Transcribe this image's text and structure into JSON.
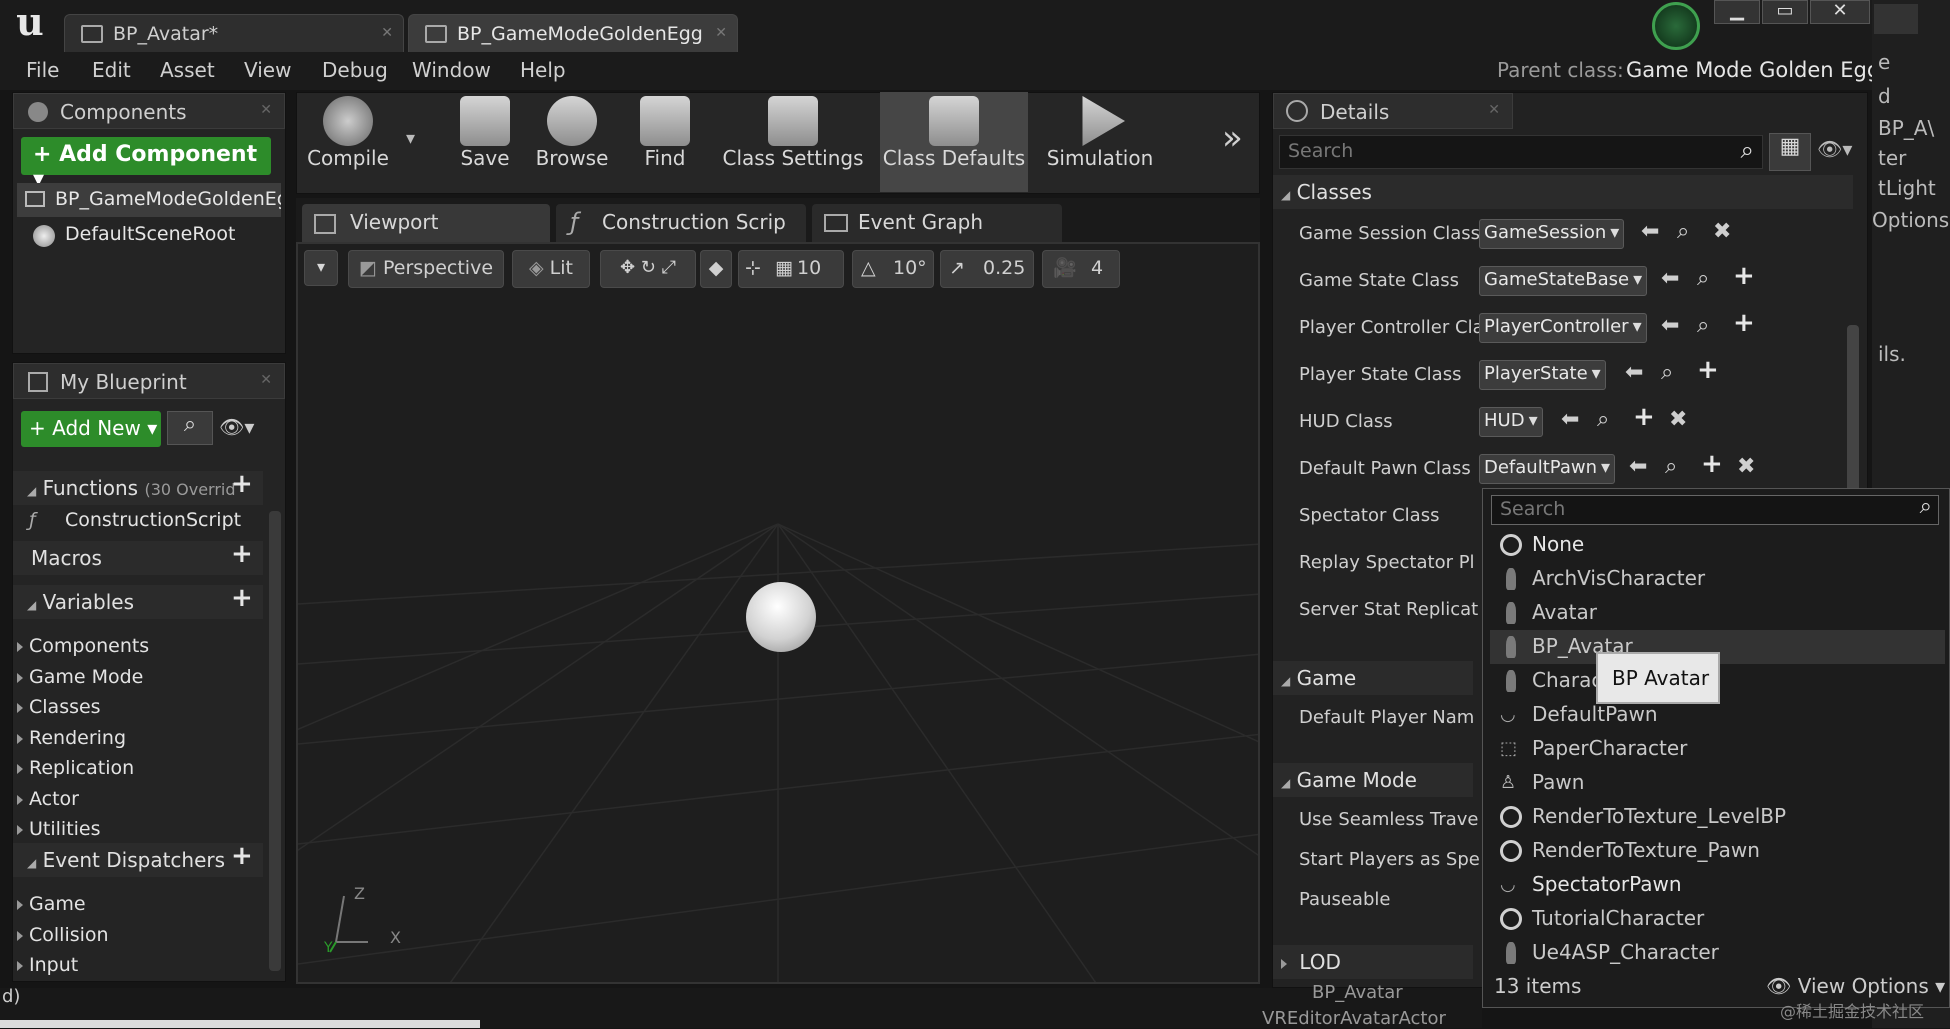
{
  "app": {
    "logo": "u"
  },
  "tabs": [
    {
      "label": "BP_Avatar*",
      "active": false
    },
    {
      "label": "BP_GameModeGoldenEgg",
      "active": true
    }
  ],
  "menu": [
    "File",
    "Edit",
    "Asset",
    "View",
    "Debug",
    "Window",
    "Help"
  ],
  "parent_class": {
    "label": "Parent class:",
    "value": "Game Mode Golden Egg"
  },
  "components_panel": {
    "title": "Components",
    "add_button": "Add Component",
    "root": "BP_GameModeGoldenEg",
    "child": "DefaultSceneRoot"
  },
  "my_blueprint": {
    "title": "My Blueprint",
    "add_new": "Add New",
    "functions": {
      "label": "Functions",
      "note": "(30 Overrid"
    },
    "construction_script": "ConstructionScript",
    "macros": "Macros",
    "variables": "Variables",
    "variable_groups": [
      "Components",
      "Game Mode",
      "Classes",
      "Rendering",
      "Replication",
      "Actor",
      "Utilities"
    ],
    "event_dispatchers": "Event Dispatchers",
    "dispatcher_groups": [
      "Game",
      "Collision",
      "Input"
    ]
  },
  "toolbar": [
    {
      "label": "Compile",
      "icon": "gear-check-icon"
    },
    {
      "label": "Save",
      "icon": "save-icon"
    },
    {
      "label": "Browse",
      "icon": "browse-icon"
    },
    {
      "label": "Find",
      "icon": "binoculars-icon"
    },
    {
      "label": "Class Settings",
      "icon": "class-settings-icon"
    },
    {
      "label": "Class Defaults",
      "icon": "class-defaults-icon",
      "active": true
    },
    {
      "label": "Simulation",
      "icon": "simulation-icon"
    }
  ],
  "editor_tabs": [
    {
      "label": "Viewport",
      "active": true
    },
    {
      "label": "Construction Scrip",
      "active": false
    },
    {
      "label": "Event Graph",
      "active": false
    }
  ],
  "viewport": {
    "perspective": "Perspective",
    "lit": "Lit",
    "grid_snap": "10",
    "rotate_snap": "10°",
    "scale_snap": "0.25",
    "camera_speed": "4",
    "axis_z": "Z",
    "axis_x": "X",
    "axis_y": "Y"
  },
  "details": {
    "title": "Details",
    "search_placeholder": "Search",
    "classes_header": "Classes",
    "rows": [
      {
        "label": "Game Session Class",
        "value": "GameSession"
      },
      {
        "label": "Game State Class",
        "value": "GameStateBase"
      },
      {
        "label": "Player Controller Cla",
        "value": "PlayerController"
      },
      {
        "label": "Player State Class",
        "value": "PlayerState"
      },
      {
        "label": "HUD Class",
        "value": "HUD"
      },
      {
        "label": "Default Pawn Class",
        "value": "DefaultPawn"
      },
      {
        "label": "Spectator Class",
        "value": ""
      },
      {
        "label": "Replay Spectator Pl",
        "value": ""
      },
      {
        "label": "Server Stat Replicat",
        "value": ""
      }
    ],
    "game_header": "Game",
    "game_rows": [
      "Default Player Nam"
    ],
    "game_mode_header": "Game Mode",
    "game_mode_rows": [
      "Use Seamless Trave",
      "Start Players as Spe",
      "Pauseable"
    ],
    "lod_header": "LOD"
  },
  "dropdown": {
    "search_placeholder": "Search",
    "items": [
      {
        "label": "None",
        "icon": "circle-icon"
      },
      {
        "label": "ArchVisCharacter",
        "icon": "pawn-icon"
      },
      {
        "label": "Avatar",
        "icon": "pawn-icon"
      },
      {
        "label": "BP_Avatar",
        "icon": "pawn-icon",
        "hovered": true
      },
      {
        "label": "Charac",
        "icon": "pawn-icon"
      },
      {
        "label": "DefaultPawn",
        "icon": "default-pawn-icon"
      },
      {
        "label": "PaperCharacter",
        "icon": "paper-character-icon"
      },
      {
        "label": "Pawn",
        "icon": "pawn-figure-icon"
      },
      {
        "label": "RenderToTexture_LevelBP",
        "icon": "circle-icon"
      },
      {
        "label": "RenderToTexture_Pawn",
        "icon": "circle-icon"
      },
      {
        "label": "SpectatorPawn",
        "icon": "spectator-icon"
      },
      {
        "label": "TutorialCharacter",
        "icon": "circle-icon"
      },
      {
        "label": "Ue4ASP_Character",
        "icon": "pawn-icon"
      }
    ],
    "tooltip": "BP Avatar",
    "count": "13 items",
    "view_options": "View Options"
  },
  "right_edge": {
    "e": "e",
    "d": "d",
    "bpa": "BP_A\\",
    "ter": "ter",
    "tlight": "tLight",
    "options": "Options",
    "ils": "ils."
  },
  "bottom_fragments": {
    "left": "d)",
    "center": "BP_Avatar",
    "center2": "VREditorAvatarActor"
  },
  "watermark": "@稀土掘金技术社区"
}
